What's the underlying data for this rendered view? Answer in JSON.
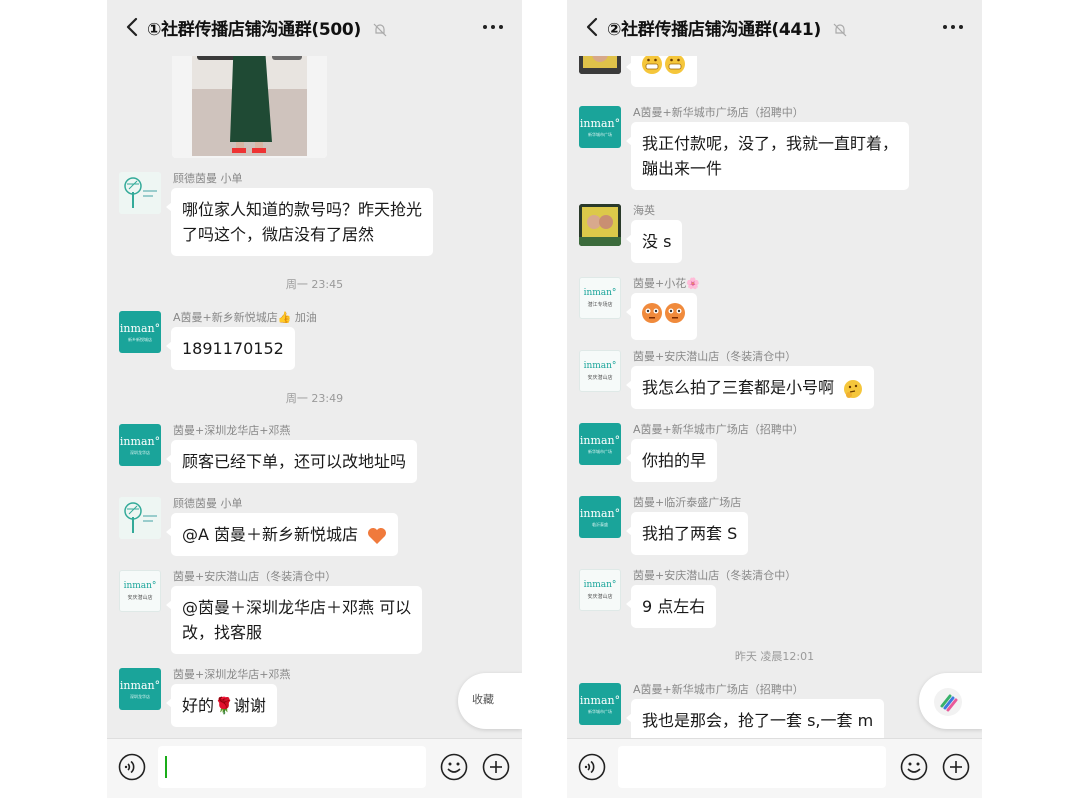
{
  "left": {
    "title": "①社群传播店铺沟通群(500)",
    "messages": [
      {
        "sender": "顾德茵曼 小单",
        "lines": [
          "哪位家人知道的款号吗？昨天抢光",
          "了吗这个，微店没有了居然"
        ]
      },
      {
        "time": "周一 23:45"
      },
      {
        "sender": "A茵曼+新乡新悦城店👍 加油",
        "lines": [
          "1891170152"
        ]
      },
      {
        "time": "周一 23:49"
      },
      {
        "sender": "茵曼+深圳龙华店+邓燕",
        "lines": [
          "顾客已经下单，还可以改地址吗"
        ]
      },
      {
        "sender": "顾德茵曼 小单",
        "lines": [
          "@A 茵曼＋新乡新悦城店"
        ]
      },
      {
        "sender": "茵曼+安庆潜山店（冬装清仓中）",
        "lines": [
          "@茵曼＋深圳龙华店＋邓燕  可以",
          "改，找客服"
        ]
      },
      {
        "sender": "茵曼+深圳龙华店+邓燕",
        "lines": [
          "好的🌹谢谢"
        ]
      }
    ],
    "float_label": "收藏"
  },
  "right": {
    "title": "②社群传播店铺沟通群(441)",
    "messages": [
      {
        "sender": "A茵曼+新华城市广场店（招聘中）",
        "lines": [
          "我正付款呢，没了，我就一直盯着，",
          "蹦出来一件"
        ]
      },
      {
        "sender": "海英",
        "lines": [
          "没 s"
        ]
      },
      {
        "sender": "茵曼+小花🌸",
        "lines": [
          ""
        ]
      },
      {
        "sender": "茵曼+安庆潜山店（冬装清仓中）",
        "lines": [
          "我怎么拍了三套都是小号啊"
        ]
      },
      {
        "sender": "A茵曼+新华城市广场店（招聘中）",
        "lines": [
          "你拍的早"
        ]
      },
      {
        "sender": "茵曼+临沂泰盛广场店",
        "lines": [
          "我拍了两套 S"
        ]
      },
      {
        "sender": "茵曼+安庆潜山店（冬装清仓中）",
        "lines": [
          "9 点左右"
        ]
      },
      {
        "time": "昨天 凌晨12:01"
      },
      {
        "sender": "A茵曼+新华城市广场店（招聘中）",
        "lines": [
          "我也是那会，抢了一套 s,一套 m"
        ]
      }
    ]
  },
  "avatar_brand": "inman°",
  "avatar_sub": [
    "新乡新悦城店",
    "深圳龙华店",
    "安庆潜山店",
    "潜江专场店",
    "新华城市广场",
    "临沂泰盛"
  ],
  "colors": {
    "accent_green": "#1aa49a",
    "chat_bg": "#ededed",
    "bubble": "#ffffff",
    "caret": "#1aad19"
  },
  "icons": [
    "back-arrow-icon",
    "mute-bell-icon",
    "more-dots-icon",
    "voice-icon",
    "emoji-icon",
    "plus-icon"
  ]
}
